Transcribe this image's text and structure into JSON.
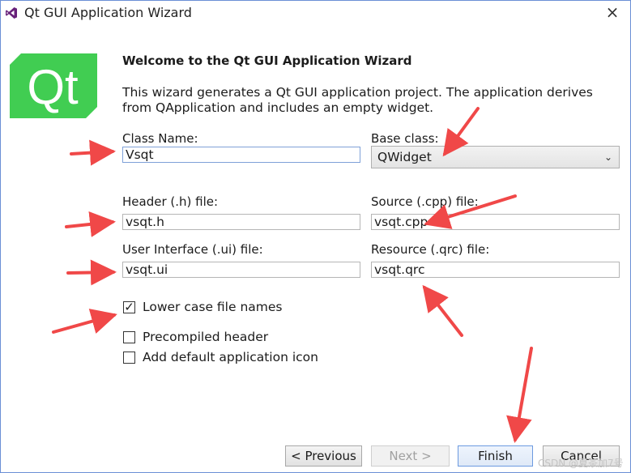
{
  "window": {
    "title": "Qt GUI Application Wizard",
    "close_glyph": "×"
  },
  "logo": {
    "text": "Qt",
    "color": "#41cd52"
  },
  "header": {
    "welcome": "Welcome to the Qt GUI Application Wizard",
    "description": "This wizard generates a Qt GUI application project. The application derives from QApplication and includes an empty widget."
  },
  "form": {
    "class_name": {
      "label": "Class Name:",
      "value": "Vsqt"
    },
    "base_class": {
      "label": "Base class:",
      "value": "QWidget",
      "icon": "chevron-down-icon"
    },
    "header_file": {
      "label": "Header (.h) file:",
      "value": "vsqt.h"
    },
    "source_file": {
      "label": "Source (.cpp) file:",
      "value": "vsqt.cpp"
    },
    "ui_file": {
      "label": "User Interface (.ui) file:",
      "value": "vsqt.ui"
    },
    "resource_file": {
      "label": "Resource (.qrc) file:",
      "value": "vsqt.qrc"
    }
  },
  "options": [
    {
      "label": "Lower case file names",
      "checked": true
    },
    {
      "label": "Precompiled header",
      "checked": false
    },
    {
      "label": "Add default application icon",
      "checked": false
    }
  ],
  "buttons": {
    "previous": "< Previous",
    "next": "Next >",
    "finish": "Finish",
    "cancel": "Cancel"
  },
  "annotation": {
    "arrow_color": "#f04848"
  },
  "watermark": "CSDN @夏茶加7号"
}
